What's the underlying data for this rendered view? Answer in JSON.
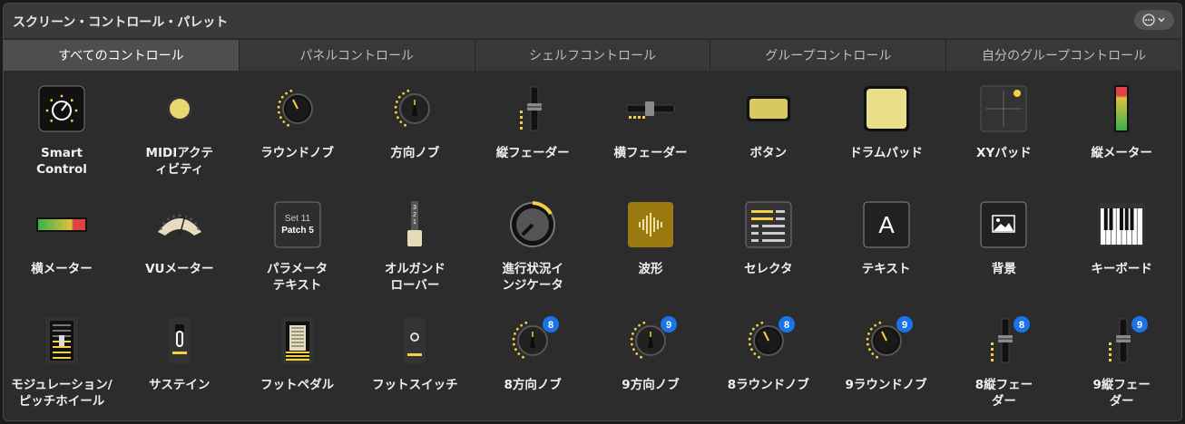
{
  "window": {
    "title": "スクリーン・コントロール・パレット"
  },
  "tabs": [
    "すべてのコントロール",
    "パネルコントロール",
    "シェルフコントロール",
    "グループコントロール",
    "自分のグループコントロール"
  ],
  "active_tab": 0,
  "controls": [
    {
      "label": "Smart\nControl",
      "icon": "smart-control-icon"
    },
    {
      "label": "MIDIアクテ\nィビティ",
      "icon": "midi-activity-icon"
    },
    {
      "label": "ラウンドノブ",
      "icon": "round-knob-icon"
    },
    {
      "label": "方向ノブ",
      "icon": "direction-knob-icon"
    },
    {
      "label": "縦フェーダー",
      "icon": "vertical-fader-icon"
    },
    {
      "label": "横フェーダー",
      "icon": "horizontal-fader-icon"
    },
    {
      "label": "ボタン",
      "icon": "button-icon"
    },
    {
      "label": "ドラムパッド",
      "icon": "drum-pad-icon"
    },
    {
      "label": "XYパッド",
      "icon": "xy-pad-icon"
    },
    {
      "label": "縦メーター",
      "icon": "vertical-meter-icon"
    },
    {
      "label": "横メーター",
      "icon": "horizontal-meter-icon"
    },
    {
      "label": "VUメーター",
      "icon": "vu-meter-icon"
    },
    {
      "label": "パラメータ\nテキスト",
      "icon": "parameter-text-icon",
      "lines": [
        "Set 11",
        "Patch 5"
      ]
    },
    {
      "label": "オルガンド\nローバー",
      "icon": "organ-drawbar-icon",
      "digits": [
        "3",
        "2",
        "1"
      ]
    },
    {
      "label": "進行状況イ\nンジケータ",
      "icon": "progress-indicator-icon"
    },
    {
      "label": "波形",
      "icon": "waveform-icon"
    },
    {
      "label": "セレクタ",
      "icon": "selector-icon"
    },
    {
      "label": "テキスト",
      "icon": "text-icon",
      "glyph": "A"
    },
    {
      "label": "背景",
      "icon": "background-image-icon"
    },
    {
      "label": "キーボード",
      "icon": "keyboard-icon"
    },
    {
      "label": "モジュレーション/\nピッチホイール",
      "icon": "mod-pitch-wheel-icon"
    },
    {
      "label": "サステイン",
      "icon": "sustain-pedal-icon"
    },
    {
      "label": "フットペダル",
      "icon": "foot-pedal-icon"
    },
    {
      "label": "フットスイッチ",
      "icon": "foot-switch-icon"
    },
    {
      "label": "8方向ノブ",
      "icon": "direction-knob-8-icon",
      "badge": "8"
    },
    {
      "label": "9方向ノブ",
      "icon": "direction-knob-9-icon",
      "badge": "9"
    },
    {
      "label": "8ラウンドノブ",
      "icon": "round-knob-8-icon",
      "badge": "8"
    },
    {
      "label": "9ラウンドノブ",
      "icon": "round-knob-9-icon",
      "badge": "9"
    },
    {
      "label": "8縦フェー\nダー",
      "icon": "vertical-fader-8-icon",
      "badge": "8"
    },
    {
      "label": "9縦フェー\nダー",
      "icon": "vertical-fader-9-icon",
      "badge": "9"
    }
  ],
  "colors": {
    "accent": "#f5d040",
    "badge": "#1a73e8"
  }
}
